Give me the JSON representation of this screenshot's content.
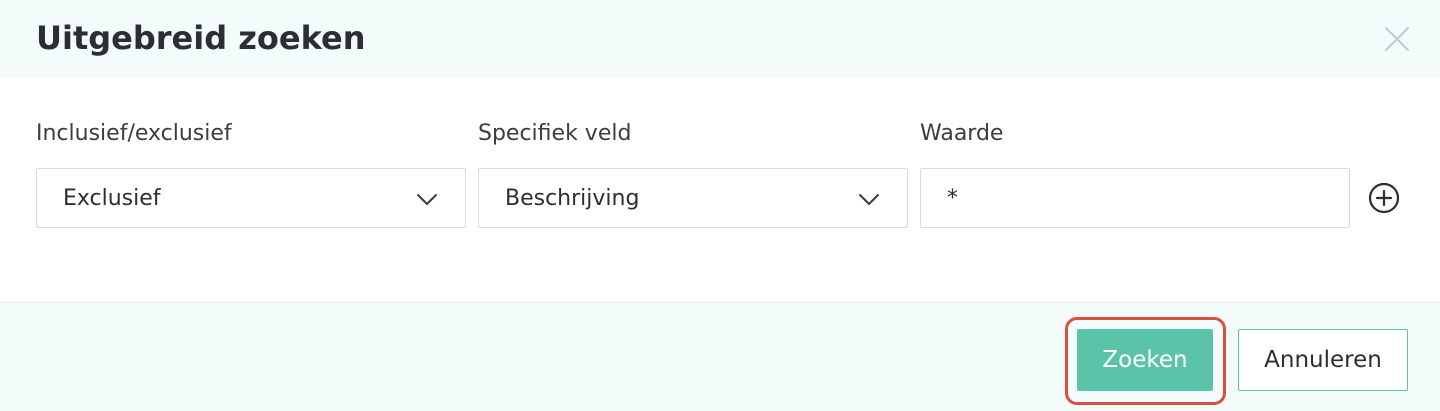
{
  "dialog": {
    "title": "Uitgebreid zoeken",
    "close_icon": "close-icon"
  },
  "fields": {
    "inclusive": {
      "label": "Inclusief/exclusief",
      "value": "Exclusief",
      "icon": "chevron-down-icon"
    },
    "field": {
      "label": "Specifiek veld",
      "value": "Beschrijving",
      "icon": "chevron-down-icon"
    },
    "value": {
      "label": "Waarde",
      "value": "*"
    },
    "add_icon": "plus-circle-icon"
  },
  "footer": {
    "search_label": "Zoeken",
    "cancel_label": "Annuleren"
  },
  "colors": {
    "accent": "#5bc4a8",
    "header_bg": "#f4fbfb",
    "highlight": "#d8503f"
  }
}
